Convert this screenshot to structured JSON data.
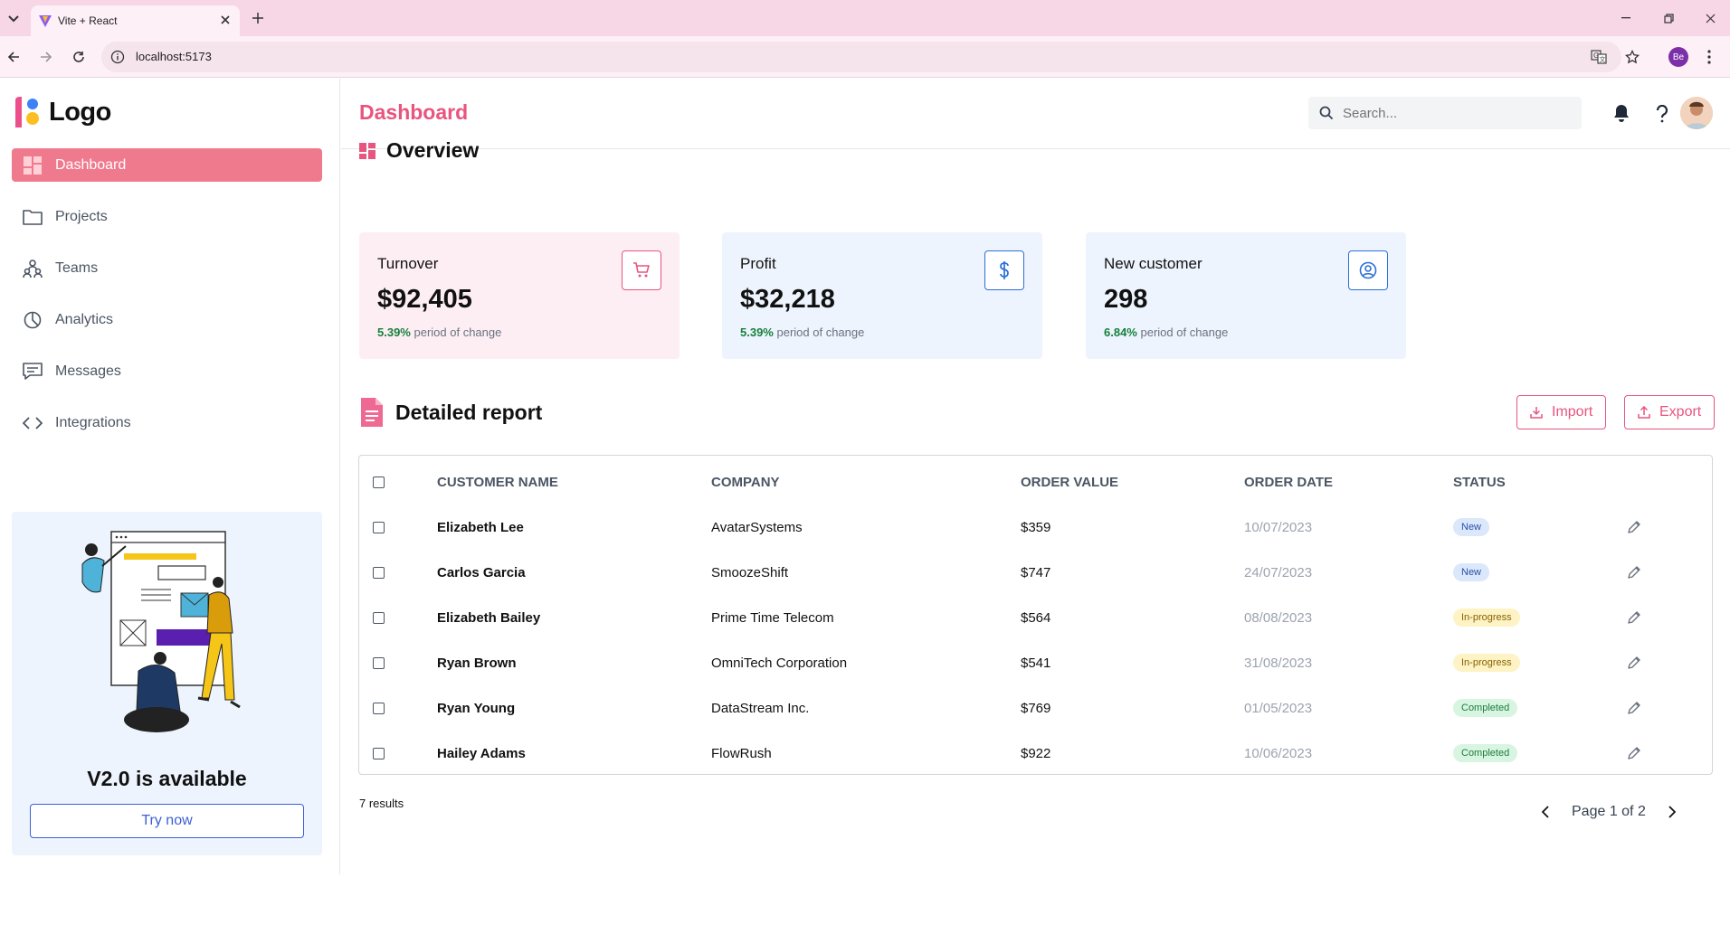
{
  "browser": {
    "tab_title": "Vite + React",
    "url": "localhost:5173",
    "profile_initials": "Be"
  },
  "app": {
    "logo_text": "Logo",
    "page_title": "Dashboard",
    "search_placeholder": "Search...",
    "accent_color": "#e8557e"
  },
  "sidebar": {
    "items": [
      {
        "label": "Dashboard",
        "icon": "grid-icon",
        "active": true
      },
      {
        "label": "Projects",
        "icon": "folder-icon"
      },
      {
        "label": "Teams",
        "icon": "team-icon"
      },
      {
        "label": "Analytics",
        "icon": "pie-chart-icon"
      },
      {
        "label": "Messages",
        "icon": "message-icon"
      },
      {
        "label": "Integrations",
        "icon": "code-icon"
      }
    ],
    "promo": {
      "title": "V2.0 is available",
      "button": "Try now"
    }
  },
  "overview": {
    "title": "Overview",
    "cards": [
      {
        "title": "Turnover",
        "value": "$92,405",
        "change": "5.39%",
        "change_text": "period of change",
        "icon": "cart-icon",
        "bg": "#fdeef3",
        "icon_color": "#e8557e"
      },
      {
        "title": "Profit",
        "value": "$32,218",
        "change": "5.39%",
        "change_text": "period of change",
        "icon": "dollar-icon",
        "bg": "#eef4fd",
        "icon_color": "#2b6fd6"
      },
      {
        "title": "New customer",
        "value": "298",
        "change": "6.84%",
        "change_text": "period of change",
        "icon": "user-circle-icon",
        "bg": "#eef4fd",
        "icon_color": "#2b6fd6"
      }
    ]
  },
  "report": {
    "title": "Detailed report",
    "import_label": "Import",
    "export_label": "Export",
    "columns": [
      "CUSTOMER NAME",
      "COMPANY",
      "ORDER VALUE",
      "ORDER DATE",
      "STATUS"
    ],
    "rows": [
      {
        "name": "Elizabeth Lee",
        "company": "AvatarSystems",
        "value": "$359",
        "date": "10/07/2023",
        "status": "New"
      },
      {
        "name": "Carlos Garcia",
        "company": "SmoozeShift",
        "value": "$747",
        "date": "24/07/2023",
        "status": "New"
      },
      {
        "name": "Elizabeth Bailey",
        "company": "Prime Time Telecom",
        "value": "$564",
        "date": "08/08/2023",
        "status": "In-progress"
      },
      {
        "name": "Ryan Brown",
        "company": "OmniTech Corporation",
        "value": "$541",
        "date": "31/08/2023",
        "status": "In-progress"
      },
      {
        "name": "Ryan Young",
        "company": "DataStream Inc.",
        "value": "$769",
        "date": "01/05/2023",
        "status": "Completed"
      },
      {
        "name": "Hailey Adams",
        "company": "FlowRush",
        "value": "$922",
        "date": "10/06/2023",
        "status": "Completed"
      }
    ],
    "results_text": "7 results",
    "pagination": "Page 1 of 2"
  }
}
